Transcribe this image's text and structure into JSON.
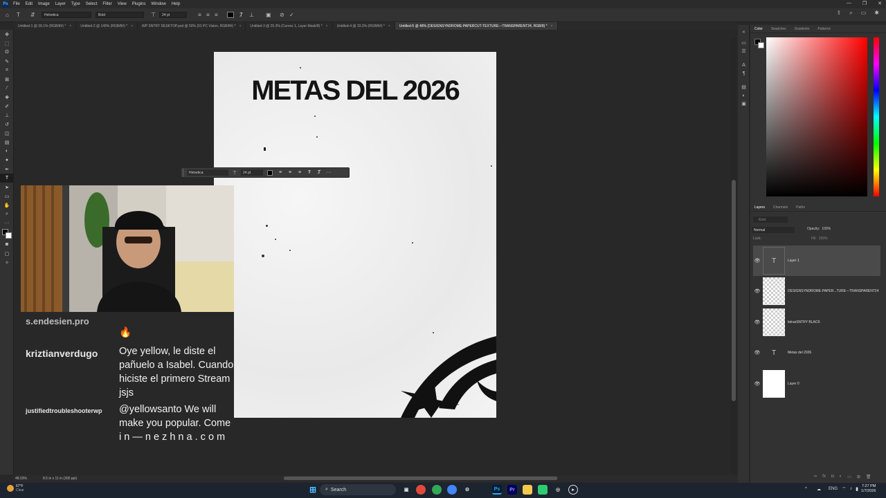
{
  "menu": [
    "File",
    "Edit",
    "Image",
    "Layer",
    "Type",
    "Select",
    "Filter",
    "View",
    "Plugins",
    "Window",
    "Help"
  ],
  "options": {
    "font_family": "Helvetica",
    "font_style": "Bold",
    "font_size": "24 pt"
  },
  "tabs": [
    {
      "label": "Untitled-1 @ 39.1% (RGB/8#) *"
    },
    {
      "label": "Untitled-2 @ 149% (RGB/8#) *"
    },
    {
      "label": "WP SNTRY DESKTOP.psd @ 50% (01 PC Vision, RGB/8#) *"
    },
    {
      "label": "Untitled-3 @ 25.3% (Curves 1, Layer Mask/8) *"
    },
    {
      "label": "Untitled-4 @ 33.3% (RGB/8#) *"
    },
    {
      "label": "Untitled-5 @ 48% (DESIGNSYNDROME-PAPERCUT-TEXTURE---TRANSPARENT24, RGB/8) *"
    }
  ],
  "artboard": {
    "title": "METAS DEL 2026"
  },
  "context_bar": {
    "font": "Helvetica",
    "size": "24 pt"
  },
  "chat": [
    {
      "user": "s.endesien.pro",
      "message": "🔥"
    },
    {
      "user": "kriztianverdugo",
      "message": "Oye yellow, le diste el pañuelo a Isabel. Cuando hiciste el primero Stream jsjs"
    },
    {
      "user": "justifiedtroubleshooterwp",
      "message": "@yellowsanto We will make you popular. Come i n — n e z h n a . c o m"
    }
  ],
  "status": {
    "zoom": "48.03%",
    "doc_size": "8.5 in x 11 in (300 ppi)"
  },
  "color_panel": {
    "tabs": [
      "Color",
      "Swatches",
      "Gradients",
      "Patterns"
    ],
    "active": "Color"
  },
  "layers_panel": {
    "tabs": [
      "Layers",
      "Channels",
      "Paths"
    ],
    "search_placeholder": "Kind",
    "blend_mode": "Normal",
    "opacity_label": "Opacity:",
    "opacity": "100%",
    "lock_label": "Lock:",
    "fill_label": "Fill:",
    "fill": "100%",
    "layers": [
      {
        "name": "Layer 1",
        "type": "text"
      },
      {
        "name": "DESIGNSYNDROME-PAPER...TURE---TRANSPARENT24",
        "type": "smart"
      },
      {
        "name": "letrasSNTRY BLACK",
        "type": "smart"
      },
      {
        "name": "Metas del 2026",
        "type": "text"
      },
      {
        "name": "Layer 0",
        "type": "pixel"
      }
    ]
  },
  "taskbar": {
    "weather_temp": "67°F",
    "weather_text": "Clear",
    "search_label": "Search",
    "lang": "ENG",
    "time": "7:27 PM",
    "date": "1/7/2026"
  },
  "colors": {
    "accent_ps": "#31a8ff",
    "canvas_bg": "#282828",
    "panel_bg": "#323232"
  }
}
